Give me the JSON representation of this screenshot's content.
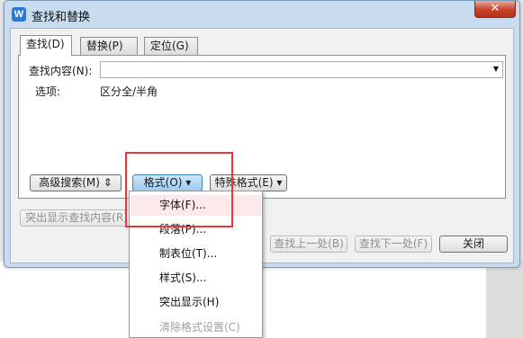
{
  "window": {
    "title": "查找和替换",
    "app_icon": "W",
    "close_symbol": "✕"
  },
  "tabs": [
    {
      "label": "查找(D)",
      "active": true
    },
    {
      "label": "替换(P)",
      "active": false
    },
    {
      "label": "定位(G)",
      "active": false
    }
  ],
  "find": {
    "label": "查找内容(N):",
    "value": "",
    "dropdown_glyph": "▼"
  },
  "options": {
    "label": "选项:",
    "value": "区分全/半角"
  },
  "buttons": {
    "advanced": "高级搜索(M) ⇕",
    "format": "格式(O) ▾",
    "special": "特殊格式(E) ▾",
    "highlight": "突出显示查找内容(R)",
    "find_prev": "查找上一处(B)",
    "find_next": "查找下一处(F)",
    "close": "关闭"
  },
  "menu": {
    "items": [
      {
        "label": "字体(F)...",
        "state": "hover"
      },
      {
        "label": "段落(P)...",
        "state": "normal"
      },
      {
        "label": "制表位(T)...",
        "state": "normal"
      },
      {
        "label": "样式(S)...",
        "state": "normal"
      },
      {
        "label": "突出显示(H)",
        "state": "normal"
      },
      {
        "label": "清除格式设置(C)",
        "state": "disabled"
      }
    ]
  },
  "colors": {
    "accent_red": "#e8373a",
    "dialog_frame": "#c9dbee",
    "menu_hover": "#fde8ea"
  }
}
